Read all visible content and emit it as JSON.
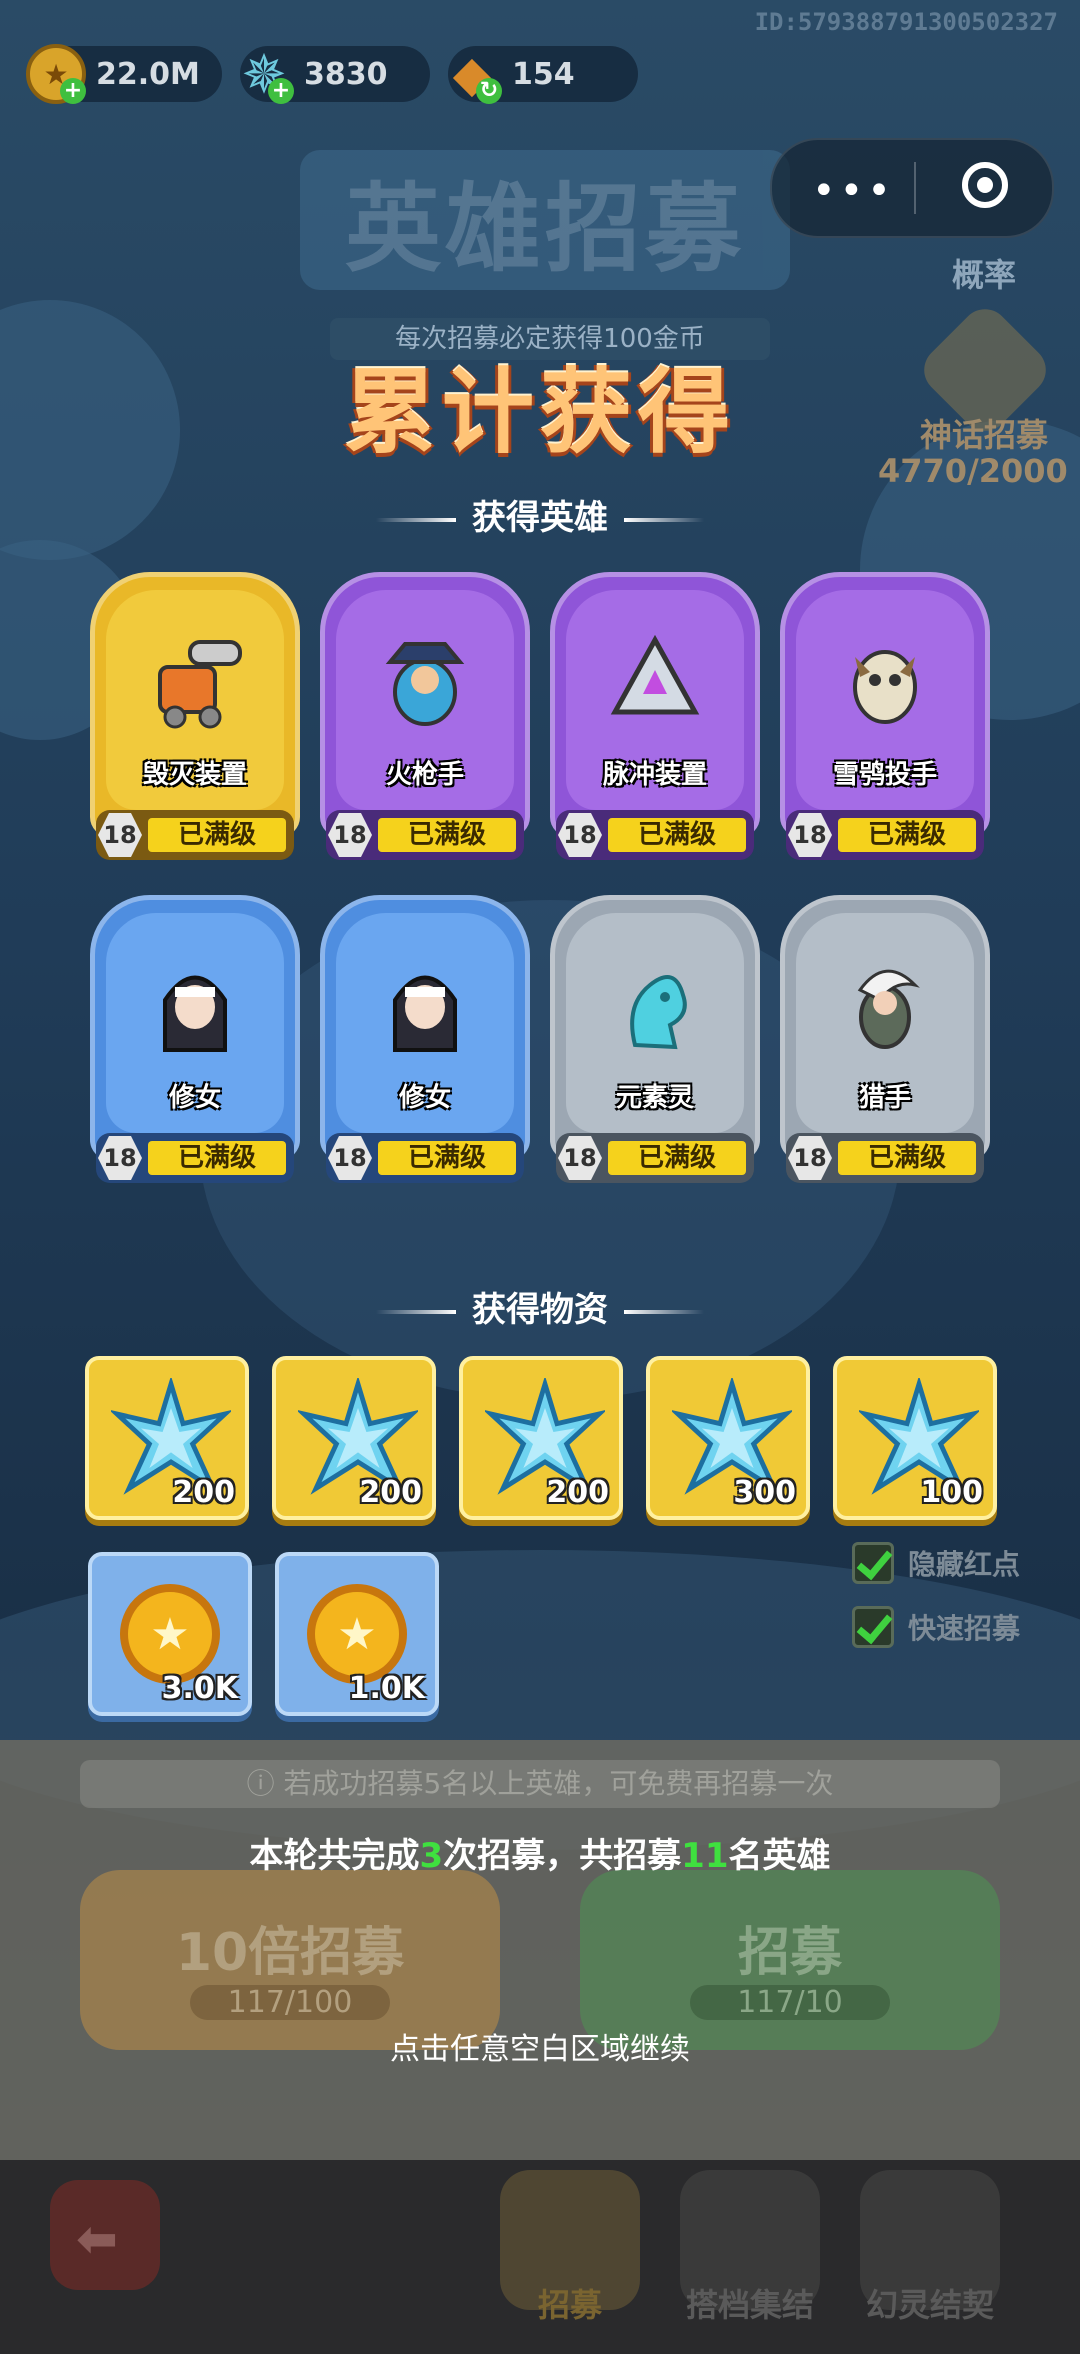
{
  "user_id": "ID:579388791300502327",
  "currencies": [
    {
      "name": "gold-coin-icon",
      "value": "22.0M"
    },
    {
      "name": "crystal-icon",
      "value": "3830"
    },
    {
      "name": "ore-icon",
      "value": "154"
    }
  ],
  "side": {
    "probability_label": "概率",
    "mythic_label": "神话招募",
    "mythic_progress": "4770/2000",
    "hide_red_dot": "隐藏红点",
    "fast_recruit": "快速招募"
  },
  "background": {
    "title": "英雄招募",
    "subtitle": "每次招募必定获得100金币",
    "tip": "ⓘ 若成功招募5名以上英雄，可免费再招募一次",
    "ten_recruit": "10倍招募",
    "ten_cost": "117/100",
    "recruit": "招募",
    "recruit_cost": "117/10",
    "nav": [
      "招募",
      "搭档集结",
      "幻灵结契"
    ]
  },
  "overlay": {
    "title": "累计获得",
    "heroes_section": "获得英雄",
    "items_section": "获得物资",
    "summary_prefix": "本轮共完成",
    "summary_count1": "3",
    "summary_mid": "次招募，共招募",
    "summary_count2": "11",
    "summary_suffix": "名英雄",
    "continue": "点击任意空白区域继续"
  },
  "heroes": [
    {
      "name": "毁灭装置",
      "level": "18",
      "status": "已满级",
      "rarity": "gold",
      "icon": "cannon-device-icon"
    },
    {
      "name": "火枪手",
      "level": "18",
      "status": "已满级",
      "rarity": "purple",
      "icon": "musketeer-icon"
    },
    {
      "name": "脉冲装置",
      "level": "18",
      "status": "已满级",
      "rarity": "purple",
      "icon": "pulse-device-icon"
    },
    {
      "name": "雪鸮投手",
      "level": "18",
      "status": "已满级",
      "rarity": "purple",
      "icon": "snow-owl-icon"
    },
    {
      "name": "修女",
      "level": "18",
      "status": "已满级",
      "rarity": "blue",
      "icon": "nun-icon"
    },
    {
      "name": "修女",
      "level": "18",
      "status": "已满级",
      "rarity": "blue",
      "icon": "nun-icon"
    },
    {
      "name": "元素灵",
      "level": "18",
      "status": "已满级",
      "rarity": "gray",
      "icon": "elemental-icon"
    },
    {
      "name": "猎手",
      "level": "18",
      "status": "已满级",
      "rarity": "gray",
      "icon": "hunter-icon"
    }
  ],
  "items": [
    {
      "type": "crystal",
      "qty": "200",
      "rarity": "gold"
    },
    {
      "type": "crystal",
      "qty": "200",
      "rarity": "gold"
    },
    {
      "type": "crystal",
      "qty": "200",
      "rarity": "gold"
    },
    {
      "type": "crystal",
      "qty": "300",
      "rarity": "gold"
    },
    {
      "type": "crystal",
      "qty": "100",
      "rarity": "gold"
    },
    {
      "type": "coin",
      "qty": "3.0K",
      "rarity": "blue"
    },
    {
      "type": "coin",
      "qty": "1.0K",
      "rarity": "blue"
    }
  ]
}
